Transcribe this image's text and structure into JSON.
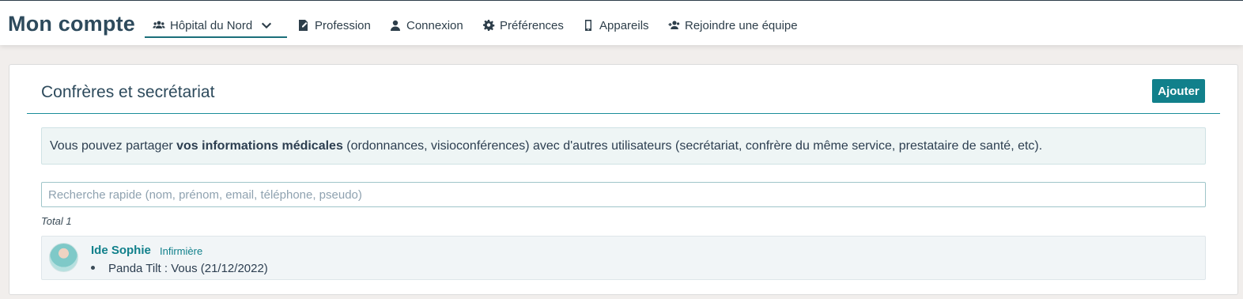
{
  "header": {
    "app_title": "Mon compte",
    "nav": [
      {
        "label": "Hôpital du Nord",
        "icon": "users-icon"
      },
      {
        "label": "Profession",
        "icon": "id-card-icon"
      },
      {
        "label": "Connexion",
        "icon": "user-icon"
      },
      {
        "label": "Préférences",
        "icon": "gear-icon"
      },
      {
        "label": "Appareils",
        "icon": "mobile-icon"
      },
      {
        "label": "Rejoindre une équipe",
        "icon": "user-plus-icon"
      }
    ]
  },
  "section": {
    "title": "Confrères et secrétariat",
    "add_label": "Ajouter",
    "info": {
      "before": "Vous pouvez partager ",
      "bold": "vos informations médicales",
      "after": " (ordonnances, visioconférences) avec d'autres utilisateurs (secrétariat, confrère du même service, prestataire de santé, etc)."
    },
    "search_placeholder": "Recherche rapide (nom, prénom, email, téléphone, pseudo)",
    "total": "Total 1",
    "people": [
      {
        "name": "Ide Sophie",
        "role": "Infirmière",
        "shares": [
          "Panda Tilt : Vous (21/12/2022)"
        ]
      }
    ]
  },
  "colors": {
    "accent": "#11808b",
    "title": "#2d4a5c",
    "background": "#f1eeec"
  }
}
